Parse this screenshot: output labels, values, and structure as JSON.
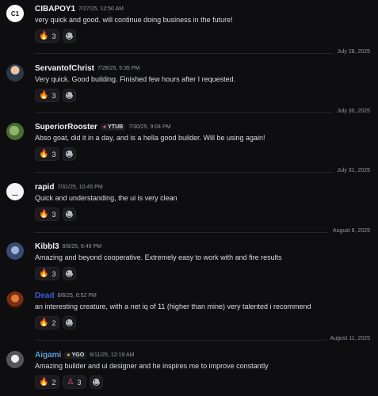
{
  "messages": [
    {
      "author": "CIBAPOY1",
      "avatar_text": "C1",
      "time": "7/27/25, 12:50 AM",
      "badge": "",
      "text": "very quick and good. will continue doing business in the future!",
      "fire": "3"
    },
    {
      "author": "ServantofChrist",
      "time": "7/28/25, 5:35 PM",
      "badge": "",
      "text": "Very quick. Good building. Finished few hours after I requested.",
      "fire": "3"
    },
    {
      "author": "SuperiorRooster",
      "time": "7/30/25, 9:04 PM",
      "badge": "YTUB",
      "text": "Abso goat, did it in a day, and is a hella good builder. Will be using again!",
      "fire": "3"
    },
    {
      "author": "rapid",
      "time": "7/31/25, 10:45 PM",
      "badge": "",
      "text": "Quick and understanding, the ui is very clean",
      "fire": "3"
    },
    {
      "author": "Kibbl3",
      "time": "8/8/25, 6:49 PM",
      "badge": "",
      "text": "Amazing and beyond cooperative. Extremely easy to work with and fire results",
      "fire": "3"
    },
    {
      "author": "Dead",
      "time": "8/8/25, 6:52 PM",
      "badge": "",
      "text": "an interesting creature, with a net iq of 11 (higher than mine) very talented i recommend",
      "fire": "2"
    },
    {
      "author": "Aigami",
      "time": "8/11/25, 12:19 AM",
      "badge": "YGO",
      "text": "Amazing builder and ui designer and he inspires me to improve constantly",
      "fire": "2",
      "second_count": "3"
    }
  ],
  "dividers": [
    "July 28, 2025",
    "July 30, 2025",
    "July 31, 2025",
    "August 8, 2025",
    "August 11, 2025"
  ],
  "colors": {
    "background": "#0e0e10",
    "author_default": "#f2f3f5",
    "author_dead": "#3b5bdb",
    "author_aigami": "#5b9bd5"
  },
  "icons": {
    "reaction_primary": "fire-icon",
    "add_reaction": "smile-icon",
    "reaction_secondary": "figure-icon"
  }
}
